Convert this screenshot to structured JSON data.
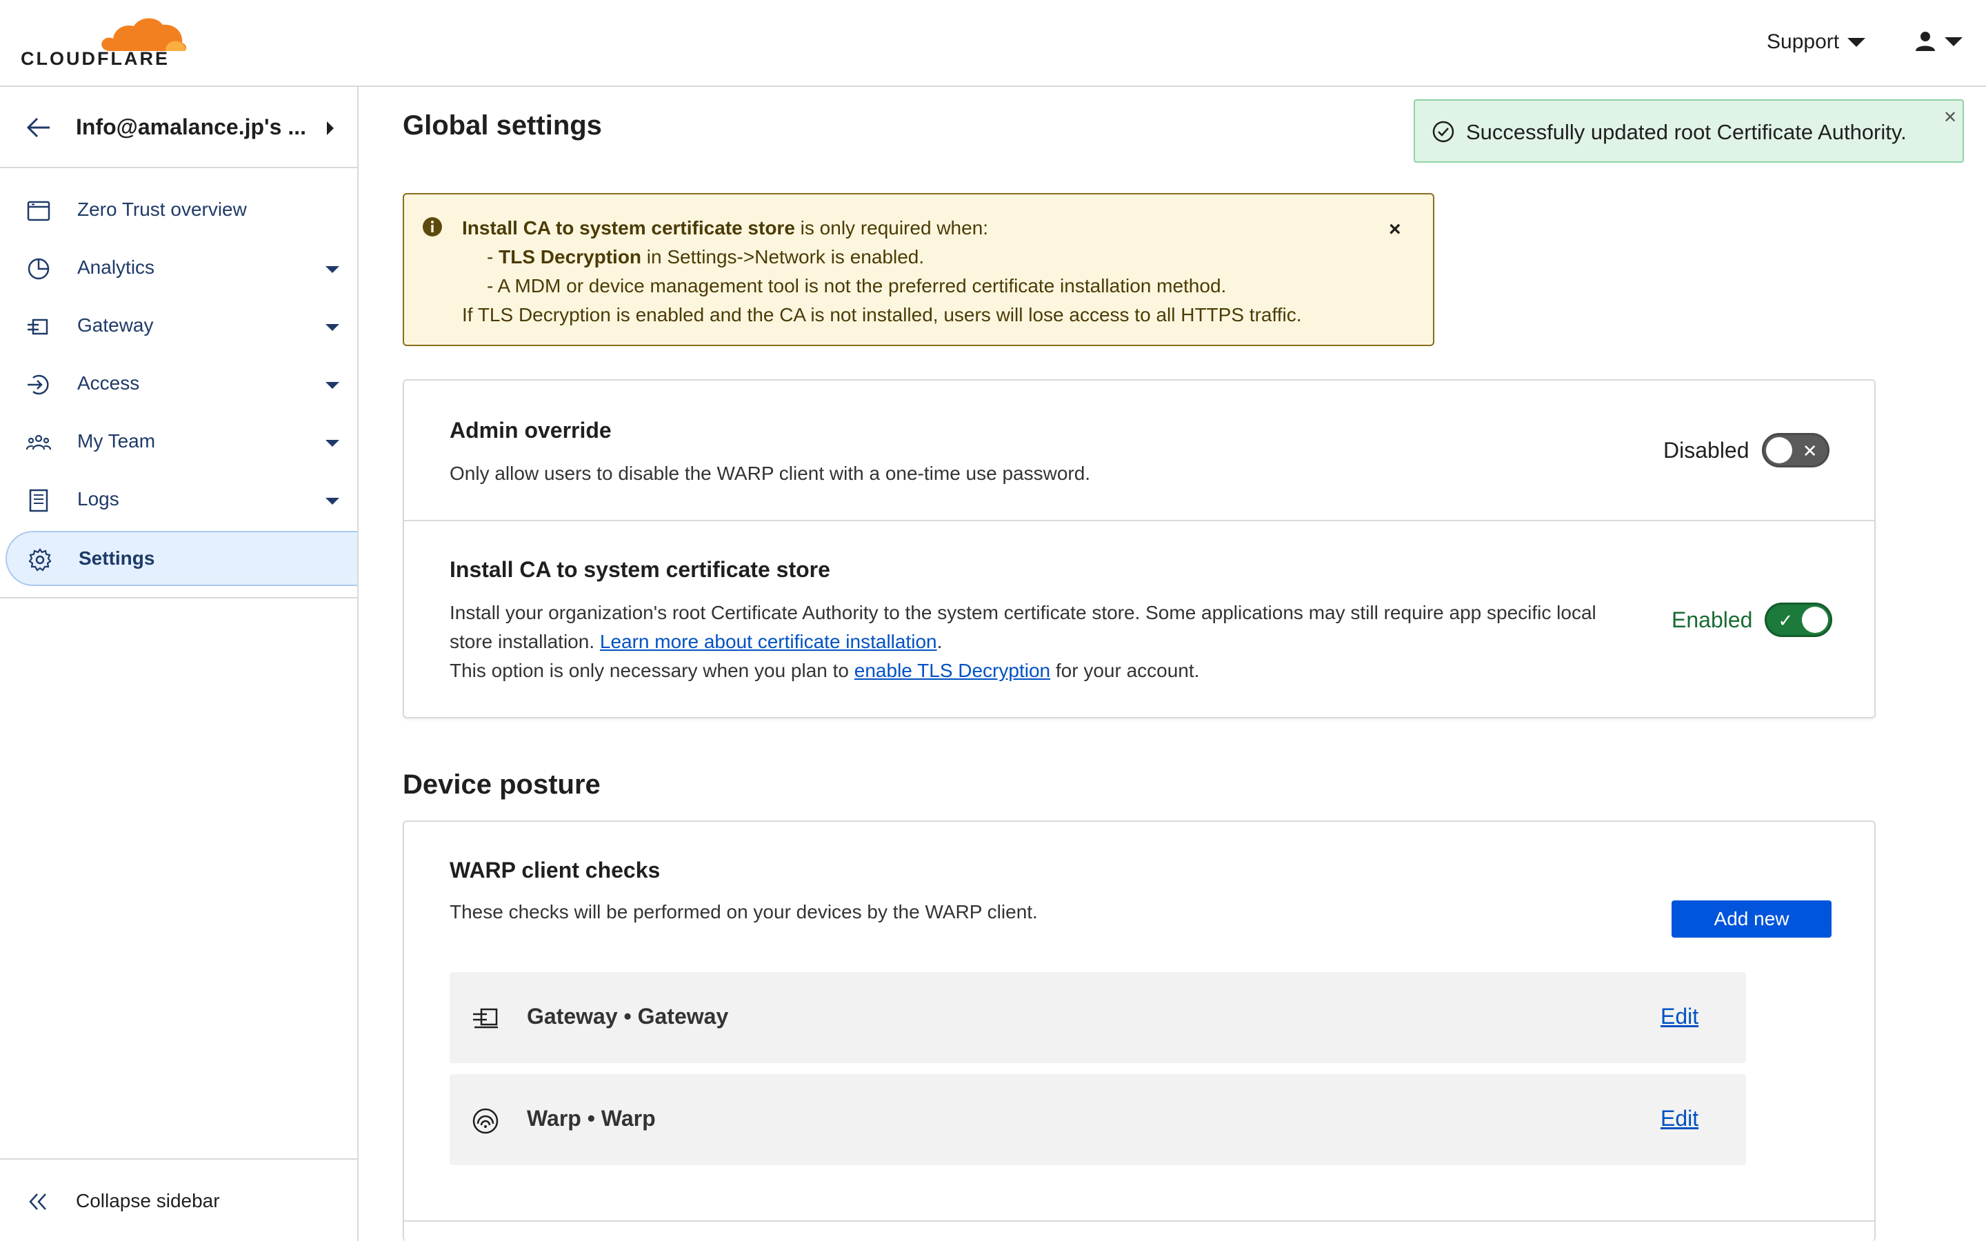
{
  "brand": {
    "name": "CLOUDFLARE",
    "cloud_color": "#f38020"
  },
  "header": {
    "support_label": "Support"
  },
  "sidebar": {
    "account_name": "Info@amalance.jp's ...",
    "items": [
      {
        "label": "Zero Trust overview",
        "icon": "browser-window-icon"
      },
      {
        "label": "Analytics",
        "icon": "pie-chart-icon"
      },
      {
        "label": "Gateway",
        "icon": "gateway-icon"
      },
      {
        "label": "Access",
        "icon": "access-icon"
      },
      {
        "label": "My Team",
        "icon": "team-icon"
      },
      {
        "label": "Logs",
        "icon": "logs-icon"
      },
      {
        "label": "Settings",
        "icon": "gear-icon"
      }
    ],
    "active": "Settings",
    "collapse_label": "Collapse sidebar"
  },
  "toast": {
    "message": "Successfully updated root Certificate Authority.",
    "color": "#dff3e6"
  },
  "page": {
    "title": "Global settings",
    "section2_title": "Device posture"
  },
  "notice": {
    "line1_bold": "Install CA to system certificate store",
    "line1_rest": " is only required when:",
    "line2_prefix": "- ",
    "line2_bold": "TLS Decryption",
    "line2_rest": " in Settings->Network is enabled.",
    "line3": "- A MDM or device management tool is not the preferred certificate installation method.",
    "line4": "If TLS Decryption is enabled and the CA is not installed, users will lose access to all HTTPS traffic."
  },
  "settings": {
    "admin_override": {
      "title": "Admin override",
      "description": "Only allow users to disable the WARP client with a one-time use password.",
      "state_label": "Disabled",
      "enabled": false
    },
    "install_ca": {
      "title": "Install CA to system certificate store",
      "desc_part1": "Install your organization's root Certificate Authority to the system certificate store. Some applications may still require app specific local store installation. ",
      "link1": "Learn more about certificate installation",
      "desc_part2": ".",
      "desc_part3": "This option is only necessary when you plan to ",
      "link2": "enable TLS Decryption",
      "desc_part4": " for your account.",
      "state_label": "Enabled",
      "enabled": true
    }
  },
  "device_posture": {
    "warp_checks_title": "WARP client checks",
    "warp_checks_desc": "These checks will be performed on your devices by the WARP client.",
    "add_new_label": "Add new",
    "checks": [
      {
        "name": "Gateway • Gateway",
        "icon": "gateway-icon",
        "edit_label": "Edit"
      },
      {
        "name": "Warp • Warp",
        "icon": "warp-icon",
        "edit_label": "Edit"
      }
    ]
  }
}
